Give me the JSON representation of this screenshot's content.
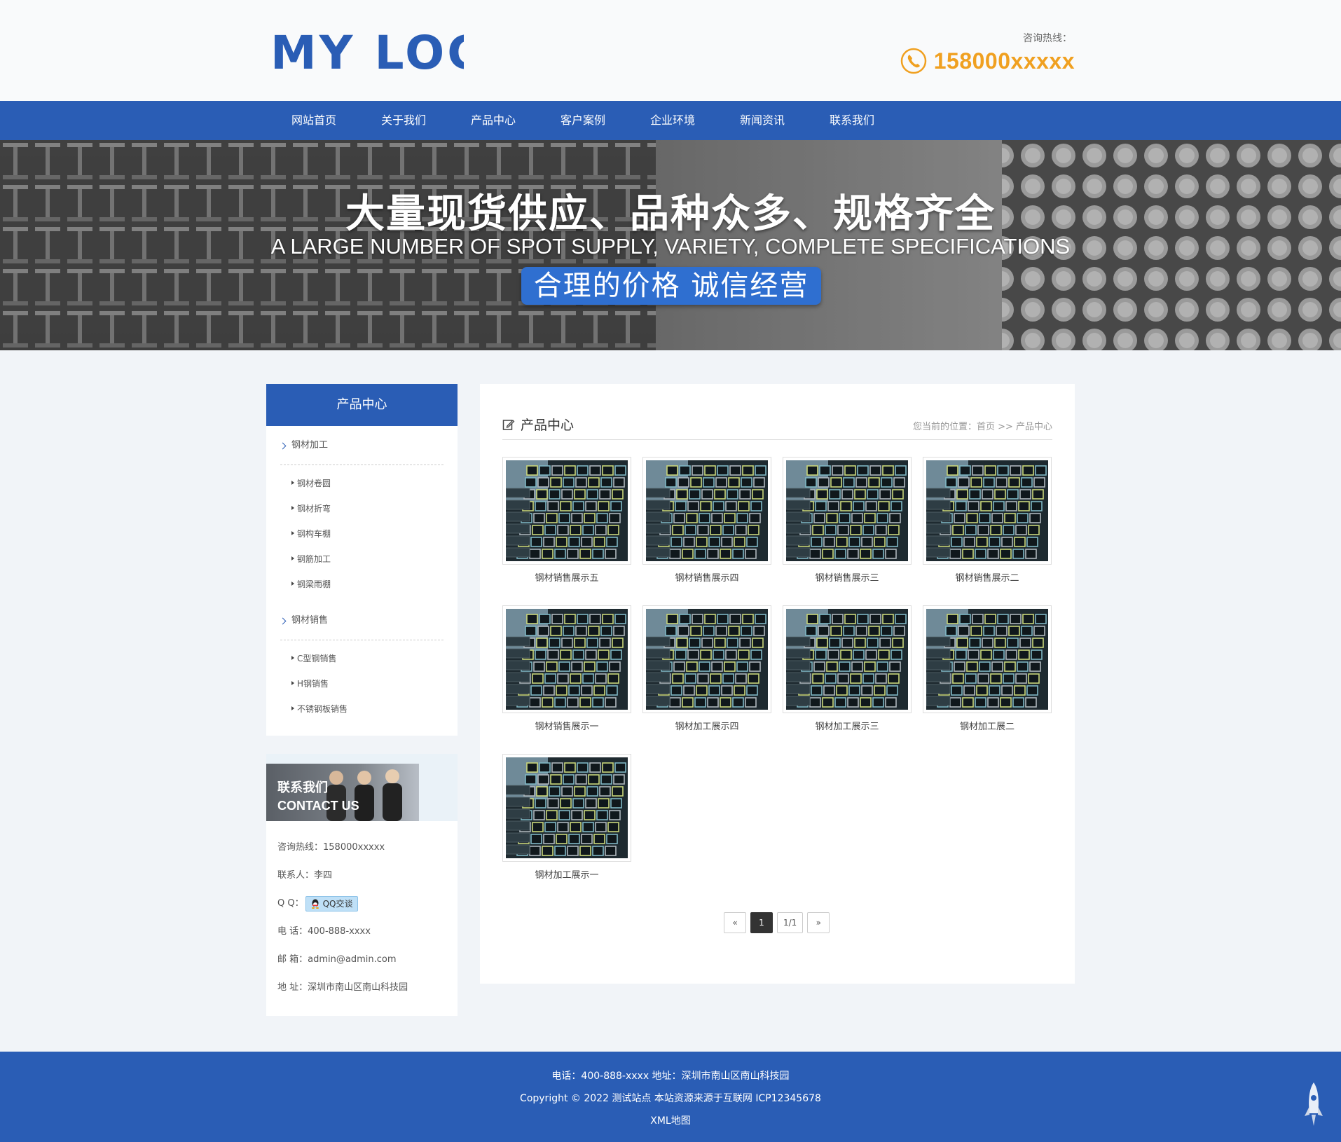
{
  "header": {
    "logo_text": "MY LOGO",
    "hotline_label": "咨询热线：",
    "hotline_number": "158000xxxxx"
  },
  "nav": {
    "items": [
      "网站首页",
      "关于我们",
      "产品中心",
      "客户案例",
      "企业环境",
      "新闻资讯",
      "联系我们"
    ]
  },
  "banner": {
    "title_cn": "大量现货供应、品种众多、规格齐全",
    "title_en": "A LARGE NUMBER OF SPOT SUPPLY, VARIETY, COMPLETE SPECIFICATIONS",
    "tagline": "合理的价格   诚信经营"
  },
  "sidebar": {
    "title": "产品中心",
    "categories": [
      {
        "label": "钢材加工",
        "items": [
          "钢材卷圆",
          "钢材折弯",
          "钢构车棚",
          "钢筋加工",
          "钢梁雨棚"
        ]
      },
      {
        "label": "钢材销售",
        "items": [
          "C型钢销售",
          "H钢销售",
          "不锈钢板销售"
        ]
      }
    ]
  },
  "contact": {
    "title_cn": "联系我们",
    "title_en": "CONTACT US",
    "hotline": "咨询热线：158000xxxxx",
    "person": "联系人：李四",
    "qq_label": "Q Q：",
    "qq_button": "QQ交谈",
    "phone": "电 话：400-888-xxxx",
    "email": "邮 箱：admin@admin.com",
    "address": "地 址：深圳市南山区南山科技园"
  },
  "main": {
    "title": "产品中心",
    "breadcrumb": "您当前的位置：首页 >> 产品中心",
    "products": [
      "钢材销售展示五",
      "钢材销售展示四",
      "钢材销售展示三",
      "钢材销售展示二",
      "钢材销售展示一",
      "钢材加工展示四",
      "钢材加工展示三",
      "钢材加工展二",
      "钢材加工展示一"
    ],
    "pager": {
      "prev": "«",
      "current": "1",
      "info": "1/1",
      "next": "»"
    }
  },
  "footer": {
    "line1": "电话：400-888-xxxx   地址：深圳市南山区南山科技园",
    "line2": "Copyright © 2022 测试站点 本站资源来源于互联网  ICP12345678",
    "line3": "XML地图"
  },
  "colors": {
    "primary": "#2a5db5",
    "accent": "#f0a020"
  }
}
